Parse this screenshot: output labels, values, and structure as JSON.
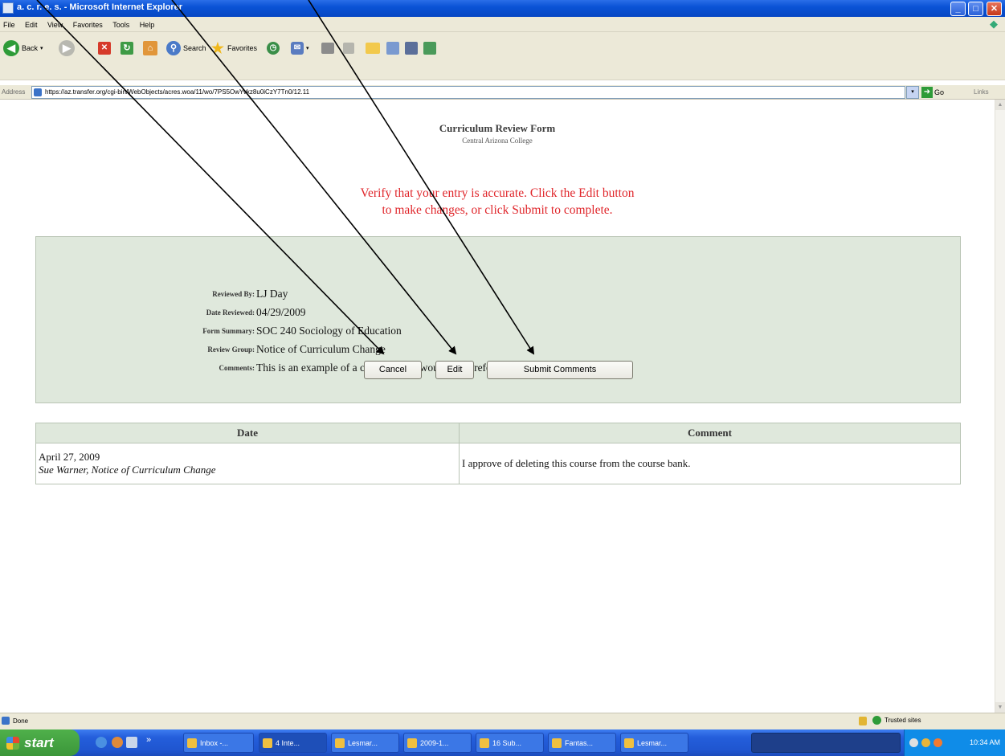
{
  "window": {
    "title": "a. c. r. e. s. - Microsoft Internet Explorer"
  },
  "menu": {
    "items": [
      "File",
      "Edit",
      "View",
      "Favorites",
      "Tools",
      "Help"
    ]
  },
  "toolbar": {
    "back": "Back",
    "search": "Search",
    "favorites": "Favorites"
  },
  "address": {
    "label": "Address",
    "url": "https://az.transfer.org/cgi-bin/WebObjects/acres.woa/11/wo/7PS5OwYvkz8u0iCzY7Tn0/12.11",
    "go": "Go",
    "links": "Links"
  },
  "page": {
    "title": "Curriculum Review Form",
    "subtitle": "Central Arizona College",
    "verify_line1": "Verify that your entry is accurate. Click the Edit button",
    "verify_line2": "to make changes, or click Submit to complete."
  },
  "review": {
    "reviewed_by_label": "Reviewed By:",
    "reviewed_by": "LJ Day",
    "date_reviewed_label": "Date Reviewed:",
    "date_reviewed": "04/29/2009",
    "form_summary_label": "Form Summary:",
    "form_summary": "SOC 240 Sociology of Education",
    "review_group_label": "Review Group:",
    "review_group": "Notice of Curriculum Change",
    "comments_label": "Comments:",
    "comments": "This is an example of a comment. Or would you prefer to submit a question?"
  },
  "buttons": {
    "cancel": "Cancel",
    "edit": "Edit",
    "submit": "Submit Comments"
  },
  "comments_table": {
    "headers": [
      "Date",
      "Comment"
    ],
    "rows": [
      {
        "date": "April 27, 2009",
        "author": "Sue Warner, Notice of Curriculum Change",
        "comment": "I approve of deleting this course from the course bank."
      }
    ]
  },
  "status": {
    "left": "Done",
    "zone": "Trusted sites"
  },
  "taskbar": {
    "start": "start",
    "tasks": [
      "Inbox -...",
      "4 Inte...",
      "Lesmar...",
      "2009-1...",
      "16 Sub...",
      "Fantas...",
      "Lesmar..."
    ],
    "clock": "10:34 AM"
  },
  "colors": {
    "verify_red": "#e0262b",
    "panel_green": "#dfe8dc",
    "xp_blue": "#0a53d6"
  }
}
